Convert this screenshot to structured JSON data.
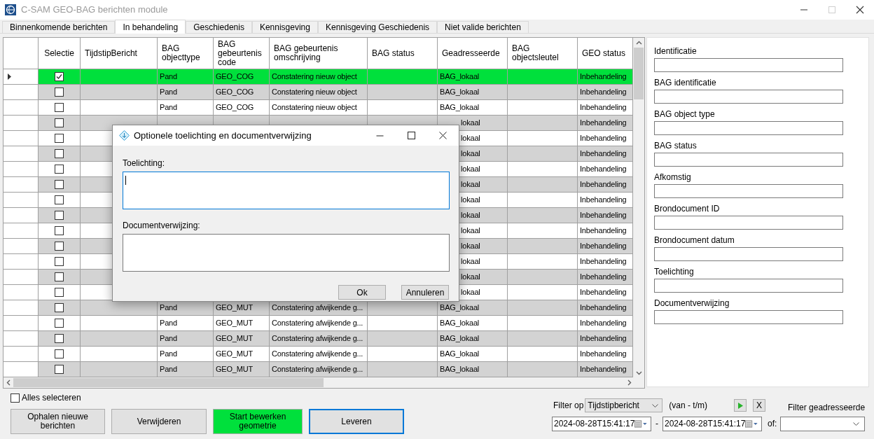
{
  "window": {
    "title": "C-SAM GEO-BAG berichten module"
  },
  "tabs": [
    {
      "label": "Binnenkomende berichten",
      "selected": false
    },
    {
      "label": "In behandeling",
      "selected": true
    },
    {
      "label": "Geschiedenis",
      "selected": false
    },
    {
      "label": "Kennisgeving",
      "selected": false
    },
    {
      "label": "Kennisgeving Geschiedenis",
      "selected": false
    },
    {
      "label": "Niet valide berichten",
      "selected": false
    }
  ],
  "grid": {
    "columns": [
      "Selectie",
      "TijdstipBericht",
      "BAG objecttype",
      "BAG gebeurtenis code",
      "BAG gebeurtenis omschrijving",
      "BAG status",
      "Geadresseerde",
      "BAG objectsleutel",
      "GEO status"
    ],
    "rows": [
      {
        "current": true,
        "selected": true,
        "checked": true,
        "object_type": "Pand",
        "event_code": "GEO_COG",
        "description": "Constatering nieuw object",
        "addressee": "BAG_lokaal",
        "geo_status": "Inbehandeling"
      },
      {
        "current": false,
        "selected": false,
        "checked": false,
        "object_type": "Pand",
        "event_code": "GEO_COG",
        "description": "Constatering nieuw object",
        "addressee": "BAG_lokaal",
        "geo_status": "Inbehandeling"
      },
      {
        "current": false,
        "selected": false,
        "checked": false,
        "object_type": "Pand",
        "event_code": "GEO_COG",
        "description": "Constatering nieuw object",
        "addressee": "BAG_lokaal",
        "geo_status": "Inbehandeling"
      },
      {
        "current": false,
        "selected": false,
        "checked": false,
        "addressee": "lokaal",
        "geo_status": "Inbehandeling"
      },
      {
        "current": false,
        "selected": false,
        "checked": false,
        "addressee": "lokaal",
        "geo_status": "Inbehandeling"
      },
      {
        "current": false,
        "selected": false,
        "checked": false,
        "addressee": "lokaal",
        "geo_status": "Inbehandeling"
      },
      {
        "current": false,
        "selected": false,
        "checked": false,
        "addressee": "lokaal",
        "geo_status": "Inbehandeling"
      },
      {
        "current": false,
        "selected": false,
        "checked": false,
        "addressee": "lokaal",
        "geo_status": "Inbehandeling"
      },
      {
        "current": false,
        "selected": false,
        "checked": false,
        "addressee": "lokaal",
        "geo_status": "Inbehandeling"
      },
      {
        "current": false,
        "selected": false,
        "checked": false,
        "addressee": "lokaal",
        "geo_status": "Inbehandeling"
      },
      {
        "current": false,
        "selected": false,
        "checked": false,
        "addressee": "lokaal",
        "geo_status": "Inbehandeling"
      },
      {
        "current": false,
        "selected": false,
        "checked": false,
        "addressee": "lokaal",
        "geo_status": "Inbehandeling"
      },
      {
        "current": false,
        "selected": false,
        "checked": false,
        "addressee": "lokaal",
        "geo_status": "Inbehandeling"
      },
      {
        "current": false,
        "selected": false,
        "checked": false,
        "addressee": "lokaal",
        "geo_status": "Inbehandeling"
      },
      {
        "current": false,
        "selected": false,
        "checked": false,
        "addressee": "lokaal",
        "geo_status": "Inbehandeling"
      },
      {
        "current": false,
        "selected": false,
        "checked": false,
        "object_type": "Pand",
        "event_code": "GEO_MUT",
        "description": "Constatering afwijkende g...",
        "addressee": "BAG_lokaal",
        "geo_status": "Inbehandeling"
      },
      {
        "current": false,
        "selected": false,
        "checked": false,
        "object_type": "Pand",
        "event_code": "GEO_MUT",
        "description": "Constatering afwijkende g...",
        "addressee": "BAG_lokaal",
        "geo_status": "Inbehandeling"
      },
      {
        "current": false,
        "selected": false,
        "checked": false,
        "object_type": "Pand",
        "event_code": "GEO_MUT",
        "description": "Constatering afwijkende g...",
        "addressee": "BAG_lokaal",
        "geo_status": "Inbehandeling"
      },
      {
        "current": false,
        "selected": false,
        "checked": false,
        "object_type": "Pand",
        "event_code": "GEO_MUT",
        "description": "Constatering afwijkende g...",
        "addressee": "BAG_lokaal",
        "geo_status": "Inbehandeling"
      },
      {
        "current": false,
        "selected": false,
        "checked": false,
        "object_type": "Pand",
        "event_code": "GEO_MUT",
        "description": "Constatering afwijkende g...",
        "addressee": "BAG_lokaal",
        "geo_status": "Inbehandeling"
      }
    ]
  },
  "details": [
    "Identificatie",
    "BAG identificatie",
    "BAG object type",
    "BAG status",
    "Afkomstig",
    "Brondocument ID",
    "Brondocument datum",
    "Toelichting",
    "Documentverwijzing"
  ],
  "select_all": {
    "label": "Alles selecteren",
    "checked": false
  },
  "buttons": [
    {
      "label": "Ophalen nieuwe berichten",
      "kind": "default",
      "focused": false
    },
    {
      "label": "Verwijderen",
      "kind": "default",
      "focused": false
    },
    {
      "label": "Start bewerken geometrie",
      "kind": "accent",
      "focused": false
    },
    {
      "label": "Leveren",
      "kind": "default",
      "focused": true
    }
  ],
  "filter": {
    "label": "Filter op",
    "field": "Tijdstipbericht",
    "range_label": "(van - t/m)",
    "clear": "X",
    "from": "2024-08-28T15:41:17",
    "separator": "-",
    "to": "2024-08-28T15:41:17",
    "or_label": "of:",
    "addressee_label": "Filter geadresseerde"
  },
  "dialog": {
    "title": "Optionele toelichting en documentverwijzing",
    "fields": [
      {
        "label": "Toelichting:",
        "focused": true
      },
      {
        "label": "Documentverwijzing:",
        "focused": false
      }
    ],
    "buttons": [
      "Ok",
      "Annuleren"
    ]
  }
}
